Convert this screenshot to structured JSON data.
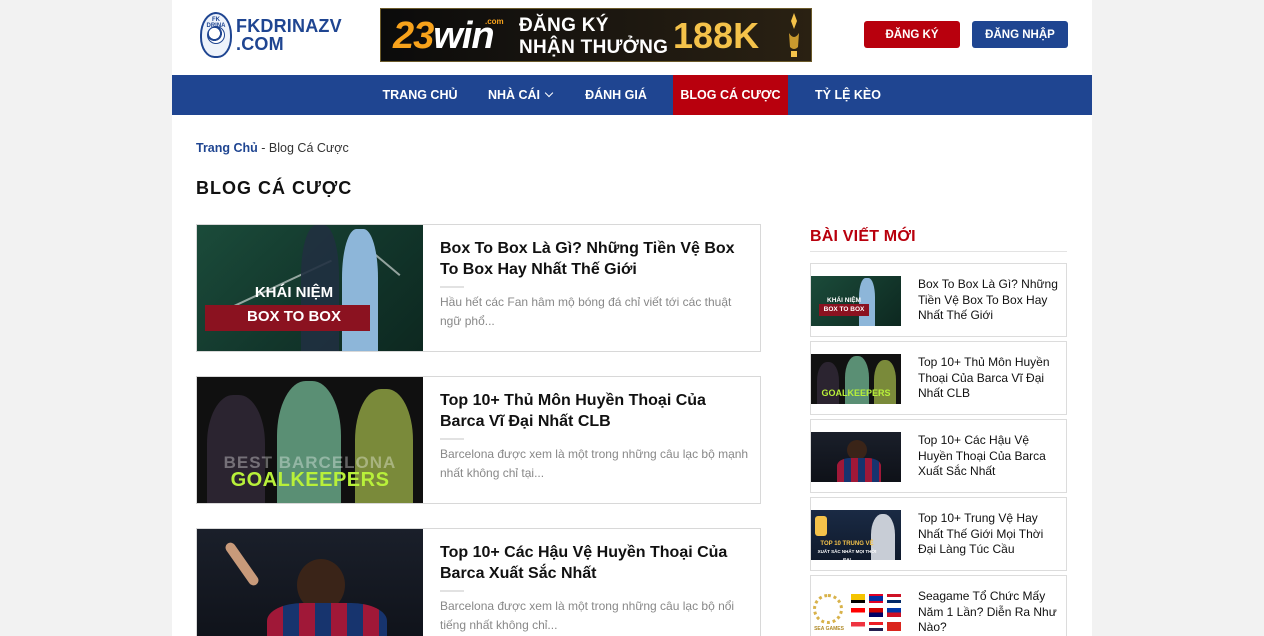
{
  "header": {
    "logo_line1": "FKDRINAZV",
    "logo_line2": ".COM",
    "logo_badge_text": "FK DRINA",
    "register_label": "ĐĂNG KÝ",
    "login_label": "ĐĂNG NHẬP"
  },
  "banner": {
    "brand_num": "23",
    "brand_word": "win",
    "brand_suffix": ".com",
    "line1": "ĐĂNG KÝ",
    "line2": "NHẬN THƯỞNG",
    "amount": "188K"
  },
  "nav": {
    "items": [
      {
        "label": "TRANG CHỦ"
      },
      {
        "label": "NHÀ CÁI"
      },
      {
        "label": "ĐÁNH GIÁ"
      },
      {
        "label": "BLOG CÁ CƯỢC"
      },
      {
        "label": "TỶ LỆ KÈO"
      }
    ]
  },
  "breadcrumb": {
    "home": "Trang Chủ",
    "separator": " - ",
    "current": "Blog Cá Cược"
  },
  "page_title": "BLOG CÁ CƯỢC",
  "articles": [
    {
      "title": "Box To Box Là Gì? Những Tiền Vệ Box To Box Hay Nhất Thế Giới",
      "excerpt": "Hầu hết các Fan hâm mộ bóng đá chỉ viết tới các thuật ngữ phổ...",
      "thumb_line1": "KHÁI NIỆM",
      "thumb_line2": "BOX TO BOX"
    },
    {
      "title": "Top 10+ Thủ Môn Huyền Thoại Của Barca Vĩ Đại Nhất CLB",
      "excerpt": "Barcelona được xem là một trong những câu lạc bộ mạnh nhất không chỉ tại...",
      "thumb_line1": "BEST BARCELONA",
      "thumb_line2": "GOALKEEPERS"
    },
    {
      "title": "Top 10+ Các Hậu Vệ Huyền Thoại Của Barca Xuất Sắc Nhất",
      "excerpt": "Barcelona được xem là một trong những câu lạc bộ nổi tiếng nhất không chỉ..."
    }
  ],
  "sidebar": {
    "title": "BÀI VIẾT MỚI",
    "items": [
      {
        "text": "Box To Box Là Gì? Những Tiền Vệ Box To Box Hay Nhất Thế Giới",
        "thumb_line1": "KHÁI NIỆM",
        "thumb_line2": "BOX TO BOX"
      },
      {
        "text": "Top 10+ Thủ Môn Huyền Thoại Của Barca Vĩ Đại Nhất CLB",
        "thumb_line1": "GOALKEEPERS"
      },
      {
        "text": "Top 10+ Các Hậu Vệ Huyền Thoại Của Barca Xuất Sắc Nhất"
      },
      {
        "text": "Top 10+ Trung Vệ Hay Nhất Thế Giới Mọi Thời Đại Làng Túc Cầu",
        "thumb_line1": "TOP 10 TRUNG VỆ",
        "thumb_line2": "XUẤT SẮC NHẤT MỌI THỜI ĐẠI"
      },
      {
        "text": "Seagame Tổ Chức Mấy Năm 1 Lần? Diễn Ra Như Nào?",
        "thumb_line1": "SEA GAMES"
      }
    ]
  },
  "colors": {
    "brand_blue": "#1f4591",
    "brand_red": "#b8000d",
    "banner_gold": "#f4c24a"
  }
}
